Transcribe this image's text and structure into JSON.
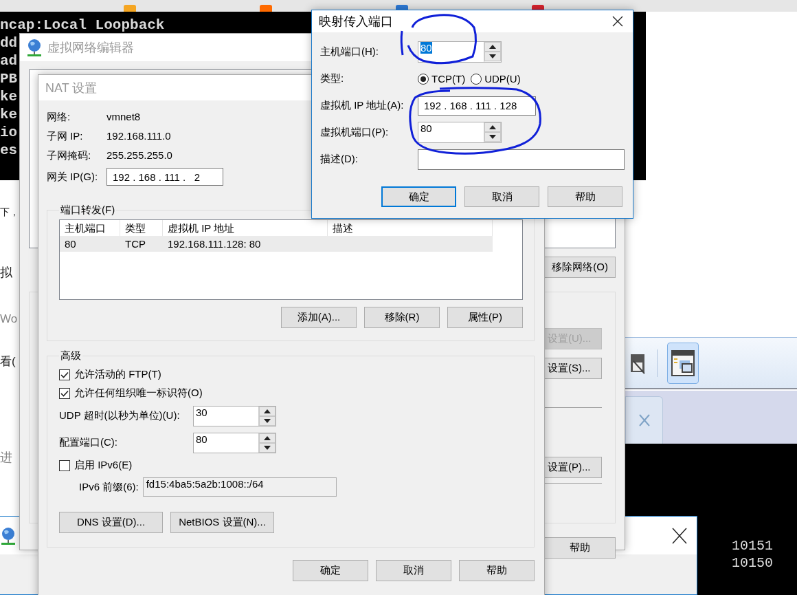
{
  "background": {
    "terminal_top_lines": [
      "ncap:Local Loopback",
      "dd",
      "ad",
      "PB",
      "ke",
      "ke",
      "io",
      "es"
    ],
    "page_fragments": [
      "下，",
      "拟",
      "Wo",
      "看(",
      "进"
    ],
    "terminal_bottom_lines": [
      "10151",
      "10150"
    ]
  },
  "editor_window": {
    "title": "虚拟网络编辑器",
    "active": false,
    "buttons": [
      {
        "label": "移除网络(O)",
        "disabled": false
      },
      {
        "label": "设置(U)...",
        "disabled": true
      },
      {
        "label": "设置(S)...",
        "disabled": false
      },
      {
        "label": "设置(P)...",
        "disabled": false
      },
      {
        "label": "帮助",
        "disabled": false
      }
    ]
  },
  "nat_window": {
    "title": "NAT 设置",
    "active": false,
    "info": [
      {
        "label": "网络:",
        "value": "vmnet8"
      },
      {
        "label": "子网 IP:",
        "value": "192.168.111.0"
      },
      {
        "label": "子网掩码:",
        "value": "255.255.255.0"
      }
    ],
    "gateway": {
      "label": "网关 IP(G):",
      "value": "192 . 168 . 111 .   2"
    },
    "port_forwarding": {
      "title": "端口转发(F)",
      "columns": [
        "主机端口",
        "类型",
        "虚拟机 IP 地址",
        "描述"
      ],
      "rows": [
        {
          "cells": [
            "80",
            "TCP",
            "192.168.111.128: 80"
          ],
          "selected": true
        }
      ],
      "buttons": [
        "添加(A)...",
        "移除(R)",
        "属性(P)"
      ]
    },
    "advanced": {
      "title": "高级",
      "checkboxes": [
        {
          "label": "允许活动的 FTP(T)",
          "checked": true
        },
        {
          "label": "允许任何组织唯一标识符(O)",
          "checked": true
        }
      ],
      "udp_timeout": {
        "label": "UDP 超时(以秒为单位)(U):",
        "value": "30"
      },
      "config_port": {
        "label": "配置端口(C):",
        "value": "80"
      },
      "ipv6": {
        "label": "启用 IPv6(E)",
        "checked": false
      },
      "ipv6_prefix": {
        "label": "IPv6 前缀(6):",
        "value": "fd15:4ba5:5a2b:1008::/64",
        "disabled": true
      },
      "buttons": [
        "DNS 设置(D)...",
        "NetBIOS 设置(N)..."
      ]
    },
    "buttons": [
      {
        "label": "确定",
        "default": false
      },
      {
        "label": "取消",
        "default": false
      },
      {
        "label": "帮助",
        "default": false
      }
    ]
  },
  "port_dialog": {
    "title": "映射传入端口",
    "active": true,
    "host_port": {
      "label": "主机端口(H):",
      "value": "80",
      "text_selected": true
    },
    "type": {
      "label": "类型:",
      "options": [
        {
          "label": "TCP(T)",
          "selected": true
        },
        {
          "label": "UDP(U)",
          "selected": false
        }
      ]
    },
    "vm_ip": {
      "label": "虚拟机 IP 地址(A):",
      "value": "192 . 168 . 111 . 128"
    },
    "vm_port": {
      "label": "虚拟机端口(P):",
      "value": "80",
      "text_selected": false
    },
    "description": {
      "label": "描述(D):"
    },
    "buttons": [
      {
        "label": "确定",
        "default": true
      },
      {
        "label": "取消",
        "default": false
      },
      {
        "label": "帮助",
        "default": false
      }
    ]
  }
}
